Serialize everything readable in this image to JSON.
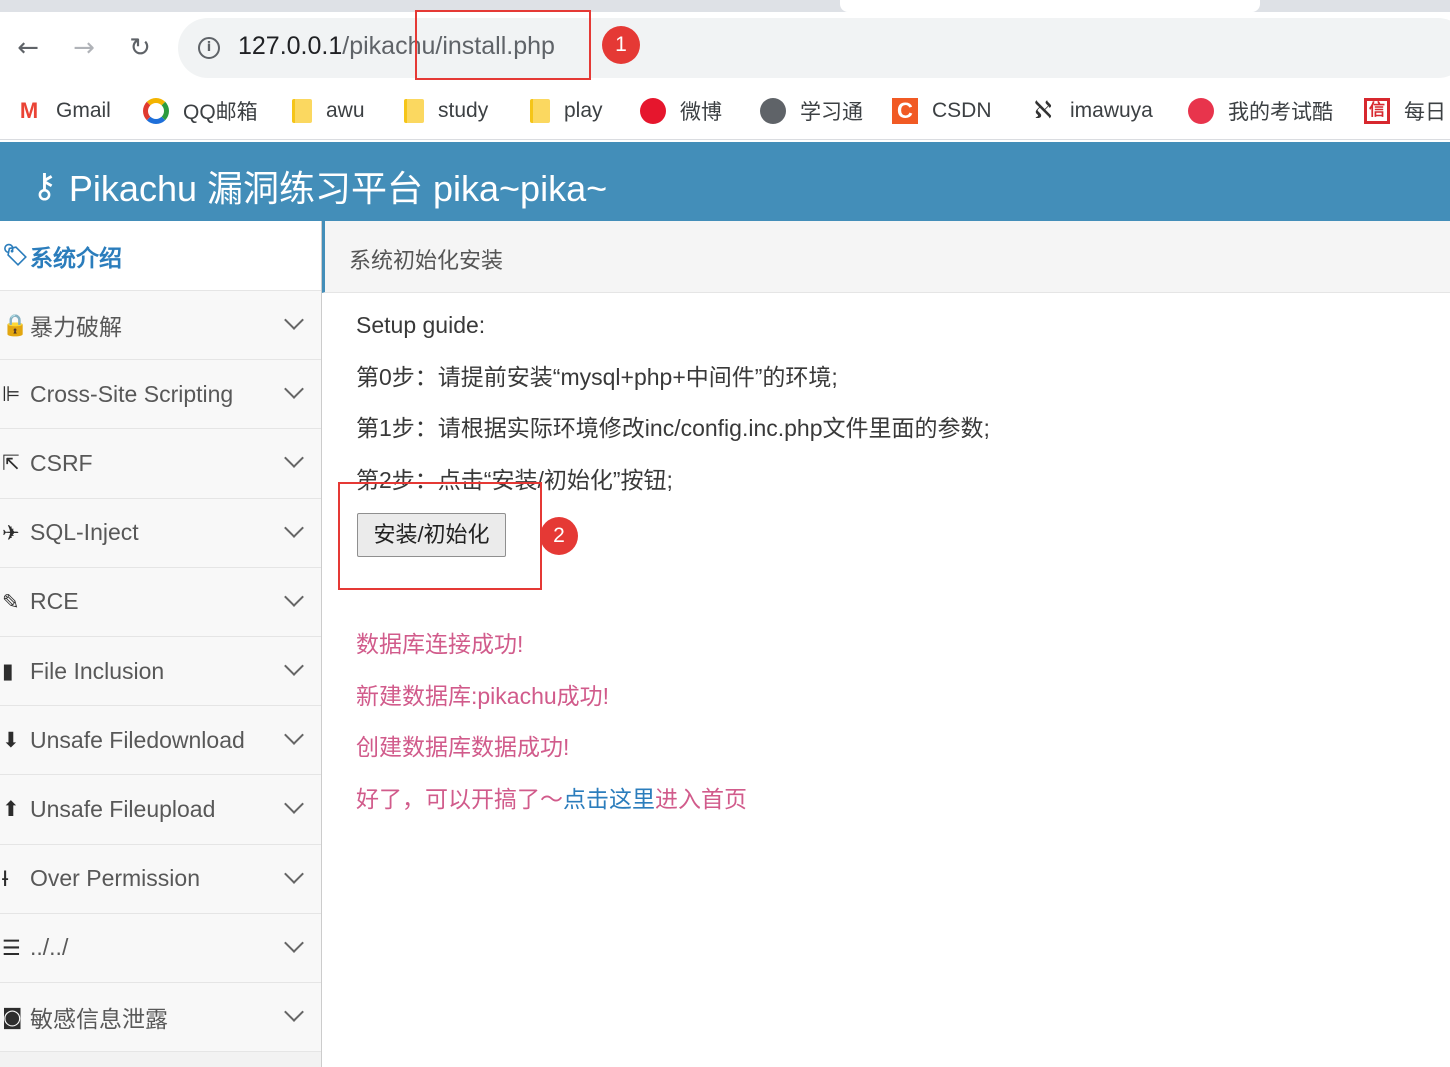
{
  "browser": {
    "url_host": "127.0.0.1",
    "url_path": "/pikachu/install.php",
    "bookmarks": [
      {
        "label": "Gmail",
        "icon": "gmail-icon"
      },
      {
        "label": "QQ邮箱",
        "icon": "qq-mail-icon"
      },
      {
        "label": "awu",
        "icon": "folder-icon"
      },
      {
        "label": "study",
        "icon": "folder-icon"
      },
      {
        "label": "play",
        "icon": "folder-icon"
      },
      {
        "label": "微博",
        "icon": "weibo-icon"
      },
      {
        "label": "学习通",
        "icon": "globe-icon"
      },
      {
        "label": "CSDN",
        "icon": "csdn-icon"
      },
      {
        "label": "imawuya",
        "icon": "imawuya-icon"
      },
      {
        "label": "我的考试酷",
        "icon": "exam-icon"
      },
      {
        "label": "每日",
        "icon": "daily-icon"
      }
    ]
  },
  "navbar": {
    "brand": "Pikachu 漏洞练习平台 pika~pika~",
    "brand_color": "#438eb9"
  },
  "sidebar": {
    "items": [
      {
        "label": "系统介绍",
        "icon": "tags-icon",
        "active": true
      },
      {
        "label": "暴力破解",
        "icon": "lock-icon"
      },
      {
        "label": "Cross-Site Scripting",
        "icon": "sitemap-icon"
      },
      {
        "label": "CSRF",
        "icon": "share-icon"
      },
      {
        "label": "SQL-Inject",
        "icon": "plane-icon"
      },
      {
        "label": "RCE",
        "icon": "pencil-icon"
      },
      {
        "label": "File Inclusion",
        "icon": "file-icon"
      },
      {
        "label": "Unsafe Filedownload",
        "icon": "download-icon"
      },
      {
        "label": "Unsafe Fileupload",
        "icon": "upload-icon"
      },
      {
        "label": "Over Permission",
        "icon": "text-height-icon"
      },
      {
        "label": "../../",
        "icon": "align-left-icon"
      },
      {
        "label": "敏感信息泄露",
        "icon": "camera-icon"
      }
    ]
  },
  "breadcrumb": "系统初始化安装",
  "content": {
    "guide_title": "Setup guide:",
    "steps": [
      "第0步：请提前安装“mysql+php+中间件”的环境;",
      "第1步：请根据实际环境修改inc/config.inc.php文件里面的参数;",
      "第2步：点击“安装/初始化”按钮;"
    ],
    "install_button": "安装/初始化",
    "messages": [
      "数据库连接成功!",
      "新建数据库:pikachu成功!",
      "创建数据库数据成功!"
    ],
    "final_prefix": "好了，可以开搞了～",
    "final_link": "点击这里",
    "final_suffix": "进入首页",
    "message_color": "#d15b8b"
  },
  "annotations": {
    "first": "1",
    "second": "2",
    "color": "#e53935"
  }
}
